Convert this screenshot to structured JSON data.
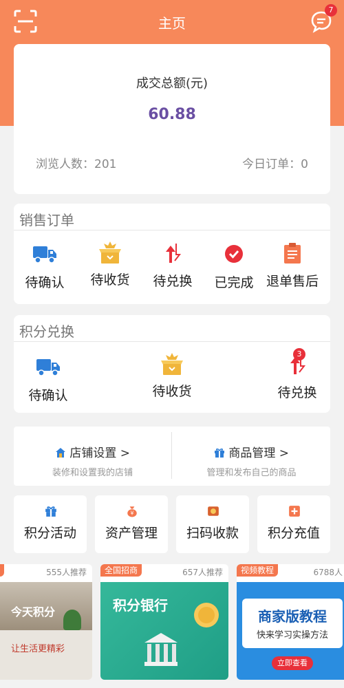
{
  "header": {
    "title": "主页",
    "message_count": "7"
  },
  "summary": {
    "label": "成交总额(元)",
    "amount": "60.88",
    "views_label": "浏览人数：201",
    "orders_label": "今日订单：0"
  },
  "sales": {
    "title": "销售订单",
    "items": [
      {
        "label": "待确认",
        "icon": "truck-icon"
      },
      {
        "label": "待收货",
        "icon": "package-icon"
      },
      {
        "label": "待兑换",
        "icon": "exchange-icon"
      },
      {
        "label": "已完成",
        "icon": "check-circle-icon"
      },
      {
        "label": "退单售后",
        "icon": "clipboard-icon"
      }
    ]
  },
  "points": {
    "title": "积分兑换",
    "items": [
      {
        "label": "待确认",
        "icon": "truck-icon"
      },
      {
        "label": "待收货",
        "icon": "package-icon"
      },
      {
        "label": "待兑换",
        "icon": "exchange-icon",
        "badge": "3"
      }
    ]
  },
  "tools": [
    {
      "title": "店铺设置 >",
      "subtitle": "装修和设置我的店铺",
      "icon": "home-icon"
    },
    {
      "title": "商品管理 >",
      "subtitle": "管理和发布自己的商品",
      "icon": "gift-icon"
    }
  ],
  "tiles": [
    {
      "label": "积分活动",
      "icon": "gift-icon"
    },
    {
      "label": "资产管理",
      "icon": "money-bag-icon"
    },
    {
      "label": "扫码收款",
      "icon": "scan-pay-icon"
    },
    {
      "label": "积分充值",
      "icon": "recharge-icon"
    }
  ],
  "banners": [
    {
      "tag": "",
      "recommend": "555人推荐",
      "img_text": "今天积分",
      "img_sub": "让生活更精彩"
    },
    {
      "tag": "全国招商",
      "recommend": "657人推荐",
      "img_text": "积分银行",
      "img_sub": ""
    },
    {
      "tag": "视频教程",
      "recommend": "6788人",
      "img_text": "商家版教程",
      "img_sub": "快来学习实操方法",
      "img_btn": "立即查看"
    }
  ],
  "colors": {
    "brand": "#f7885a",
    "amount": "#6a4fa3",
    "badge": "#e8303a",
    "blue": "#2f7fd8",
    "gold": "#f0b53a"
  }
}
